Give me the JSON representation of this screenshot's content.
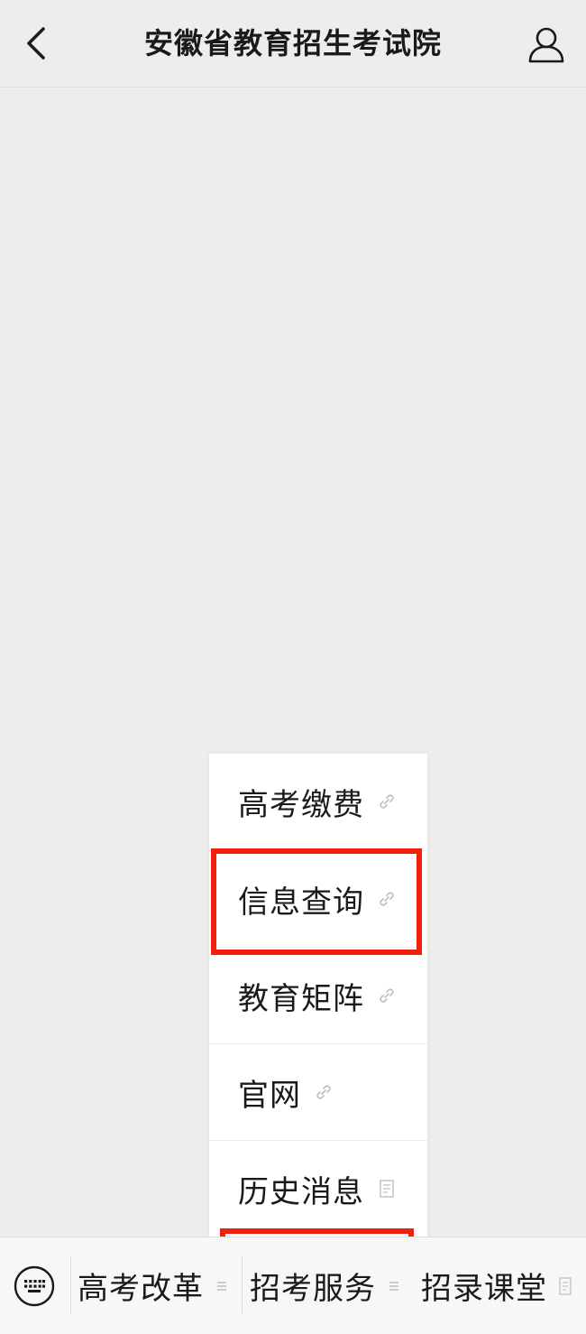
{
  "header": {
    "title": "安徽省教育招生考试院",
    "back_icon": "chevron-left-icon",
    "profile_icon": "person-icon"
  },
  "submenu": {
    "items": [
      {
        "label": "高考缴费",
        "icon": "link-icon"
      },
      {
        "label": "信息查询",
        "icon": "link-icon"
      },
      {
        "label": "教育矩阵",
        "icon": "link-icon"
      },
      {
        "label": "官网",
        "icon": "link-icon"
      },
      {
        "label": "历史消息",
        "icon": "article-icon"
      }
    ]
  },
  "bottom_menu": {
    "keyboard_icon": "keyboard-icon",
    "tabs": [
      {
        "label": "高考改革",
        "icon": "menu-lines-icon"
      },
      {
        "label": "招考服务",
        "icon": "menu-lines-icon"
      },
      {
        "label": "招录课堂",
        "icon": "article-icon"
      }
    ]
  },
  "colors": {
    "background": "#ededed",
    "highlight": "#f0200c",
    "text": "#1a1a1a"
  }
}
